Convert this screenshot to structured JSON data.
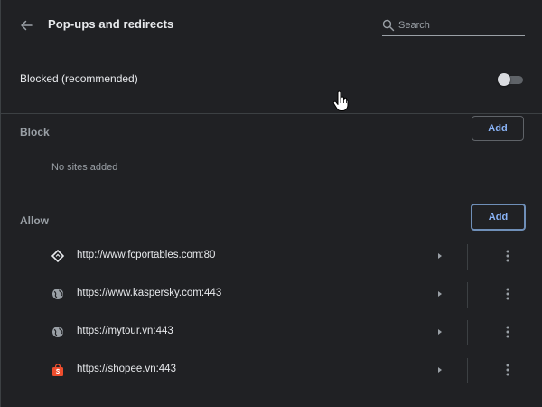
{
  "header": {
    "title": "Pop-ups and redirects",
    "search_placeholder": "Search"
  },
  "blocked": {
    "label": "Blocked (recommended)",
    "toggle_on": false
  },
  "block_section": {
    "label": "Block",
    "add_label": "Add",
    "empty_text": "No sites added"
  },
  "allow_section": {
    "label": "Allow",
    "add_label": "Add",
    "sites": [
      {
        "url": "http://www.fcportables.com:80",
        "icon": "diamond-favicon-icon"
      },
      {
        "url": "https://www.kaspersky.com:443",
        "icon": "globe-icon"
      },
      {
        "url": "https://mytour.vn:443",
        "icon": "globe-icon"
      },
      {
        "url": "https://shopee.vn:443",
        "icon": "shopee-bag-icon"
      }
    ]
  },
  "colors": {
    "background": "#202124",
    "accent": "#8ab4f8",
    "text": "#e8eaed",
    "muted": "#9aa0a6",
    "shopee": "#ee4d2d"
  }
}
